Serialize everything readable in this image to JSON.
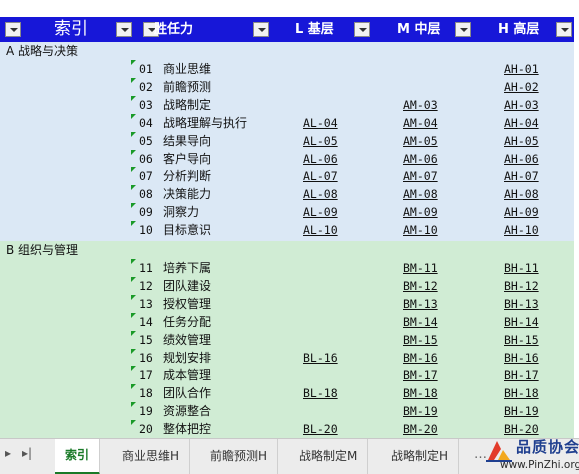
{
  "header": {
    "index_label": "索引",
    "col_ability": "胜任力",
    "col_l": "L 基层",
    "col_m": "M 中层",
    "col_h": "H 高层"
  },
  "sections": [
    {
      "title": "A 战略与决策",
      "rows": [
        {
          "num": "01",
          "name": "商业思维",
          "l": "",
          "m": "",
          "h": "AH-01"
        },
        {
          "num": "02",
          "name": "前瞻预测",
          "l": "",
          "m": "",
          "h": "AH-02"
        },
        {
          "num": "03",
          "name": "战略制定",
          "l": "",
          "m": "AM-03",
          "h": "AH-03"
        },
        {
          "num": "04",
          "name": "战略理解与执行",
          "l": "AL-04",
          "m": "AM-04",
          "h": "AH-04"
        },
        {
          "num": "05",
          "name": "结果导向",
          "l": "AL-05",
          "m": "AM-05",
          "h": "AH-05"
        },
        {
          "num": "06",
          "name": "客户导向",
          "l": "AL-06",
          "m": "AM-06",
          "h": "AH-06"
        },
        {
          "num": "07",
          "name": "分析判断",
          "l": "AL-07",
          "m": "AM-07",
          "h": "AH-07"
        },
        {
          "num": "08",
          "name": "决策能力",
          "l": "AL-08",
          "m": "AM-08",
          "h": "AH-08"
        },
        {
          "num": "09",
          "name": "洞察力",
          "l": "AL-09",
          "m": "AM-09",
          "h": "AH-09"
        },
        {
          "num": "10",
          "name": "目标意识",
          "l": "AL-10",
          "m": "AM-10",
          "h": "AH-10"
        }
      ]
    },
    {
      "title": "B 组织与管理",
      "rows": [
        {
          "num": "11",
          "name": "培养下属",
          "l": "",
          "m": "BM-11",
          "h": "BH-11"
        },
        {
          "num": "12",
          "name": "团队建设",
          "l": "",
          "m": "BM-12",
          "h": "BH-12"
        },
        {
          "num": "13",
          "name": "授权管理",
          "l": "",
          "m": "BM-13",
          "h": "BH-13"
        },
        {
          "num": "14",
          "name": "任务分配",
          "l": "",
          "m": "BM-14",
          "h": "BH-14"
        },
        {
          "num": "15",
          "name": "绩效管理",
          "l": "",
          "m": "BM-15",
          "h": "BH-15"
        },
        {
          "num": "16",
          "name": "规划安排",
          "l": "BL-16",
          "m": "BM-16",
          "h": "BH-16"
        },
        {
          "num": "17",
          "name": "成本管理",
          "l": "",
          "m": "BM-17",
          "h": "BH-17"
        },
        {
          "num": "18",
          "name": "团队合作",
          "l": "BL-18",
          "m": "BM-18",
          "h": "BH-18"
        },
        {
          "num": "19",
          "name": "资源整合",
          "l": "",
          "m": "BM-19",
          "h": "BH-19"
        },
        {
          "num": "20",
          "name": "整体把控",
          "l": "BL-20",
          "m": "BM-20",
          "h": "BH-20"
        }
      ]
    }
  ],
  "tabs": [
    "索引",
    "商业思维H",
    "前瞻预测H",
    "战略制定M",
    "战略制定H"
  ],
  "active_tab": 0,
  "watermark": {
    "title": "品质协会",
    "url": "www.PinZhi.org"
  },
  "colors": {
    "header_bg": "#1717d8",
    "section_a_bg": "#dbe8f5",
    "section_b_bg": "#d0ecd4",
    "tab_active": "#1a7a28"
  }
}
